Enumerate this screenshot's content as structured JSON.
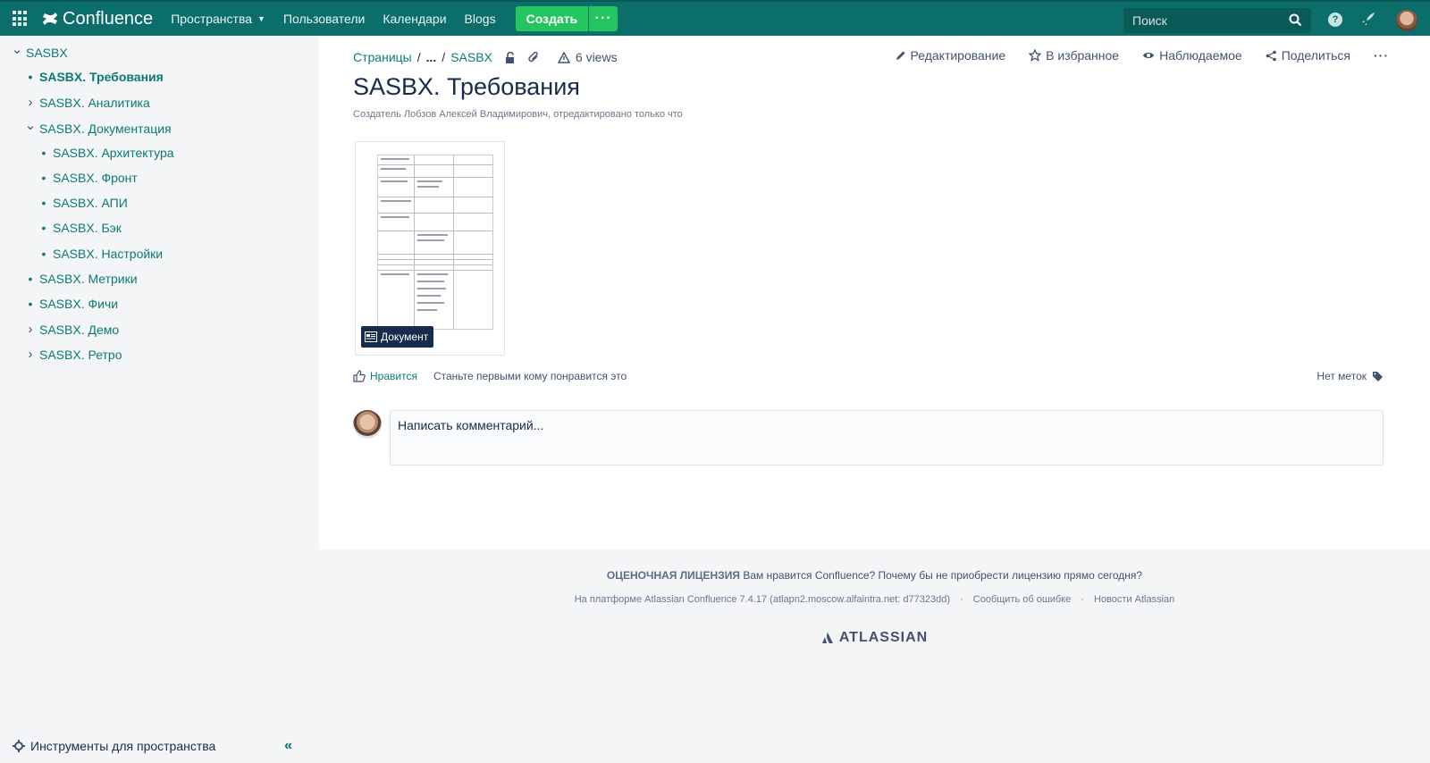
{
  "topnav": {
    "app_name": "Confluence",
    "items": [
      {
        "label": "Пространства",
        "has_caret": true
      },
      {
        "label": "Пользователи"
      },
      {
        "label": "Календари"
      },
      {
        "label": "Blogs"
      }
    ],
    "create_label": "Создать",
    "more_label": "···",
    "search_placeholder": "Поиск",
    "help_label": "?"
  },
  "sidebar": {
    "tree": [
      {
        "label": "SASBX",
        "marker": "chevron-down",
        "level": 0
      },
      {
        "label": "SASBX. Требования",
        "marker": "bullet",
        "level": 1,
        "active": true
      },
      {
        "label": "SASBX. Аналитика",
        "marker": "chevron-right",
        "level": 1
      },
      {
        "label": "SASBX. Документация",
        "marker": "chevron-down",
        "level": 1
      },
      {
        "label": "SASBX. Архитектура",
        "marker": "bullet",
        "level": 2
      },
      {
        "label": "SASBX. Фронт",
        "marker": "bullet",
        "level": 2
      },
      {
        "label": "SASBX. АПИ",
        "marker": "bullet",
        "level": 2
      },
      {
        "label": "SASBX. Бэк",
        "marker": "bullet",
        "level": 2
      },
      {
        "label": "SASBX. Настройки",
        "marker": "bullet",
        "level": 2
      },
      {
        "label": "SASBX. Метрики",
        "marker": "bullet",
        "level": 1
      },
      {
        "label": "SASBX. Фичи",
        "marker": "bullet",
        "level": 1
      },
      {
        "label": "SASBX. Демо",
        "marker": "chevron-right",
        "level": 1
      },
      {
        "label": "SASBX. Ретро",
        "marker": "chevron-right",
        "level": 1
      }
    ],
    "footer_label": "Инструменты для пространства"
  },
  "page": {
    "breadcrumb": {
      "pages": "Страницы",
      "sep1": "/",
      "ellipsis": "...",
      "sep2": "/",
      "space": "SASBX"
    },
    "views": "6 views",
    "actions": {
      "edit": "Редактирование",
      "favorite": "В избранное",
      "watch": "Наблюдаемое",
      "share": "Поделиться",
      "more": "···"
    },
    "title": "SASBX. Требования",
    "byline": "Создатель Лобзов Алексей Владимирович, отредактировано только что",
    "attachment_badge": "Документ",
    "like_label": "Нравится",
    "like_text": "Станьте первыми кому понравится это",
    "labels_text": "Нет меток",
    "comment_placeholder": "Написать комментарий..."
  },
  "footer": {
    "license_bold": "ОЦЕНОЧНАЯ ЛИЦЕНЗИЯ",
    "license_text": "Вам нравится Confluence? Почему бы не приобрести лицензию прямо сегодня?",
    "platform": "На платформе Atlassian Confluence 7.4.17 (atlapn2.moscow.alfaintra.net: d77323dd)",
    "report_bug": "Сообщить об ошибке",
    "news": "Новости Atlassian",
    "dot": "·",
    "brand": "ATLASSIAN"
  },
  "colors": {
    "topnav": "#0b6e6b",
    "link": "#0b7a74",
    "create": "#22c55e"
  }
}
